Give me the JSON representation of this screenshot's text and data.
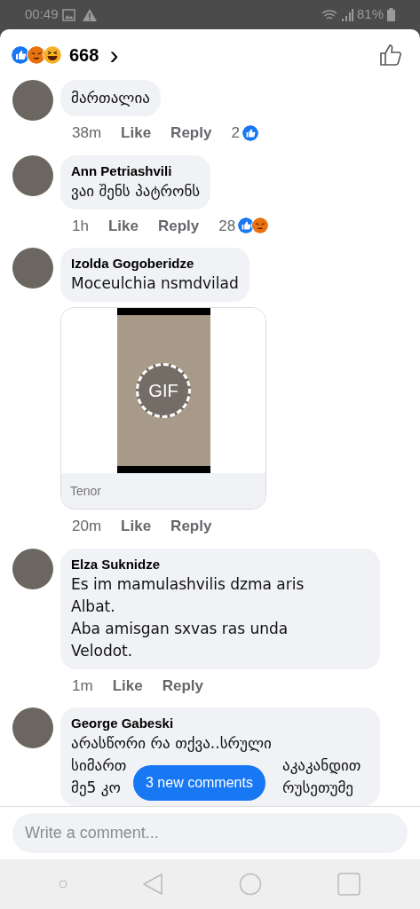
{
  "status_bar": {
    "time": "00:49",
    "battery": "81%"
  },
  "header": {
    "reactions": [
      {
        "kind": "like"
      },
      {
        "kind": "angry"
      },
      {
        "kind": "haha"
      }
    ],
    "count": "668",
    "chevron": "›"
  },
  "comments": [
    {
      "lines": [
        [
          "მართალია"
        ]
      ],
      "time": "38m",
      "actions": [
        "Like",
        "Reply"
      ],
      "reaction_count": "2",
      "reactions": [
        {
          "kind": "like"
        }
      ]
    },
    {
      "author": "Ann Petriashvili",
      "lines": [
        [
          "ვაი შენს პატრონს"
        ]
      ],
      "time": "1h",
      "actions": [
        "Like",
        "Reply"
      ],
      "reaction_count": "28",
      "reactions": [
        {
          "kind": "like"
        },
        {
          "kind": "angry"
        }
      ]
    },
    {
      "author": "Izolda Gogoberidze",
      "lines": [
        [
          "Moceulchia nsmdvilad"
        ]
      ],
      "time": "20m",
      "actions": [
        "Like",
        "Reply"
      ],
      "attachment": {
        "badge": "GIF",
        "source": "Tenor"
      }
    },
    {
      "author": "Elza Suknidze",
      "lines": [
        [
          "Es im mamulashvilis dzma aris"
        ],
        [
          "Albat."
        ],
        [
          "Aba amisgan sxvas ras unda"
        ],
        [
          "Velodot."
        ]
      ],
      "time": "1m",
      "actions": [
        "Like",
        "Reply"
      ]
    },
    {
      "author": "George Gabeski",
      "lines": [
        [
          "არასწორი რა თქვა..სრული"
        ],
        [
          "სიმართ",
          "აკაკანდით"
        ],
        [
          "მე5 კო",
          "რუსეთუმე"
        ]
      ]
    }
  ],
  "new_comments": "3 new comments",
  "composer": {
    "placeholder": "Write a comment..."
  }
}
